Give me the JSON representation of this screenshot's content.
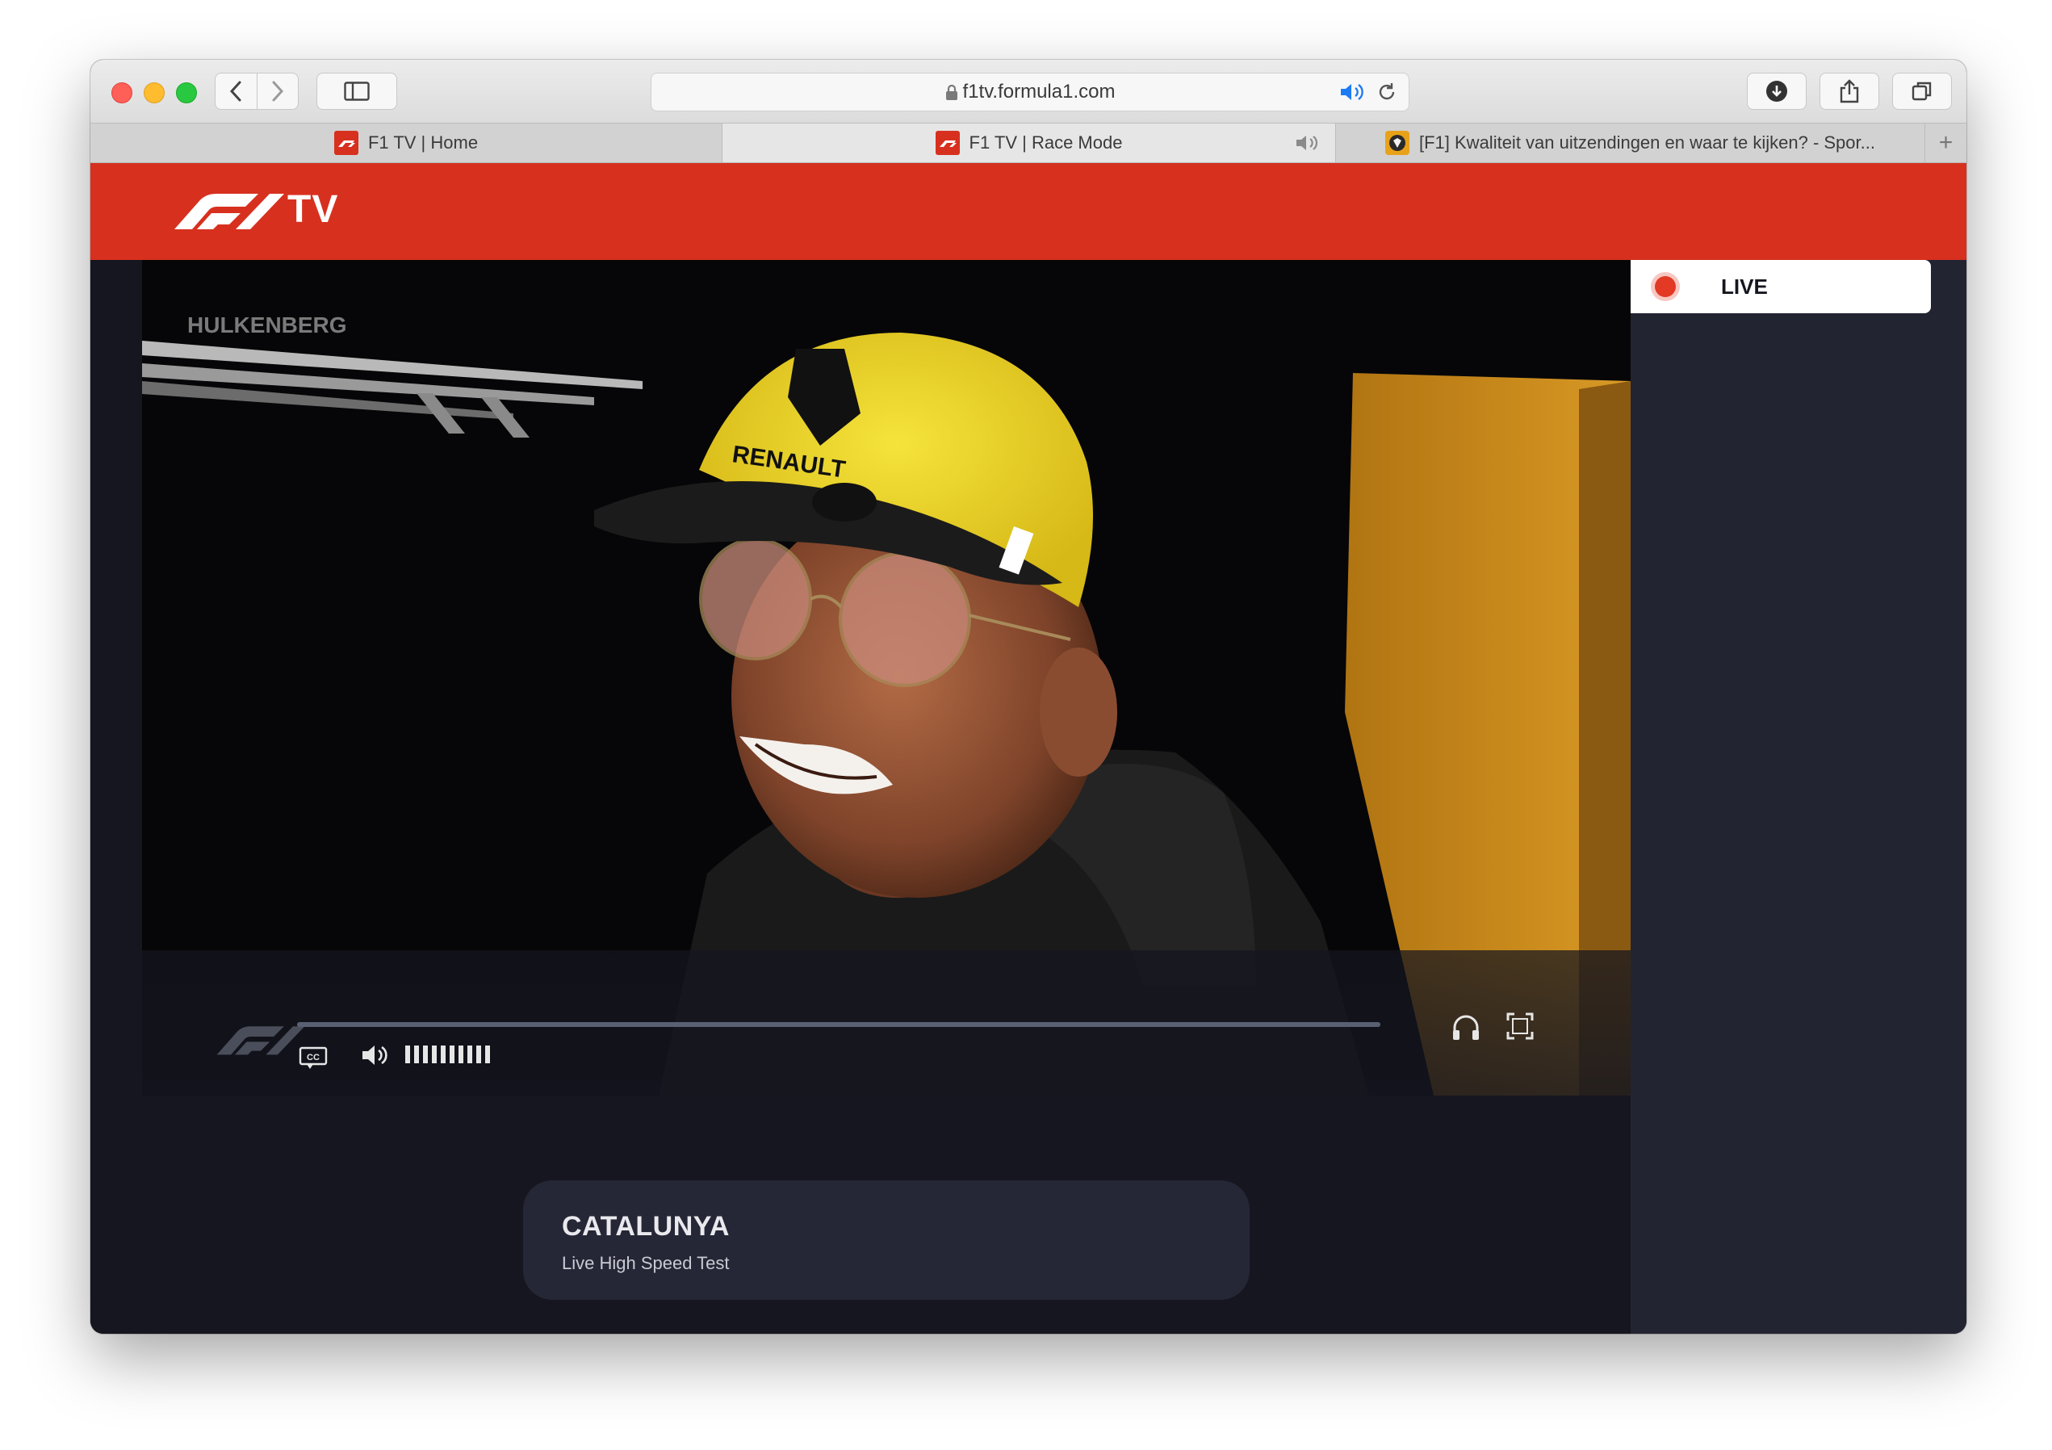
{
  "browser": {
    "url": "f1tv.formula1.com",
    "tabs": [
      {
        "label": "F1 TV | Home",
        "favicon": "f1-favicon",
        "active": false
      },
      {
        "label": "F1 TV | Race Mode",
        "favicon": "f1-favicon",
        "active": true,
        "audio": true
      },
      {
        "label": "[F1] Kwaliteit van uitzendingen en waar te kijken? - Spor...",
        "favicon": "forum-favicon",
        "active": false
      }
    ],
    "new_tab_label": "+"
  },
  "header": {
    "logo_text": "TV",
    "brand_color": "#d7301f"
  },
  "player": {
    "progress": 1.0,
    "volume_level": 10,
    "controls": [
      "cc-icon",
      "volume-icon",
      "headphones-icon",
      "fullscreen-icon"
    ]
  },
  "side_panel": {
    "live_label": "LIVE",
    "live_color": "#e23a25"
  },
  "event": {
    "title": "CATALUNYA",
    "subtitle": "Live High Speed Test"
  }
}
